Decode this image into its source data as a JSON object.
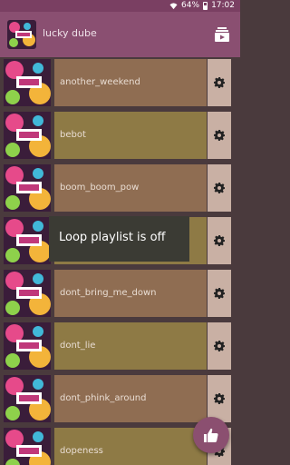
{
  "status_bar": {
    "battery": "64%",
    "time": "17:02",
    "icons": [
      "wifi-icon",
      "battery-icon"
    ]
  },
  "app_bar": {
    "title": "lucky dube",
    "art_icon": "music-art-icon",
    "action_icon": "playlist-icon"
  },
  "songs": [
    {
      "title": "another_weekend"
    },
    {
      "title": "bebot"
    },
    {
      "title": "boom_boom_pow"
    },
    {
      "title": ""
    },
    {
      "title": "dont_bring_me_down"
    },
    {
      "title": "dont_lie"
    },
    {
      "title": "dont_phink_around"
    },
    {
      "title": "dopeness"
    }
  ],
  "row_action_icon": "gear-icon",
  "toast": {
    "message": "Loop playlist is off"
  },
  "fab": {
    "icon": "thumbs-up-icon"
  },
  "colors": {
    "background": "#4a3a3d",
    "app_bar": "#8a4f71",
    "row_brown": "#8f6d52",
    "row_olive": "#8e7a45",
    "gear_panel": "#c9b0a4",
    "fab": "#8b4f70",
    "toast": "#3b3b34"
  }
}
